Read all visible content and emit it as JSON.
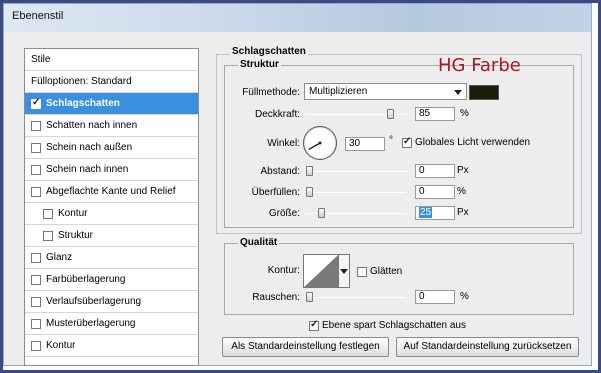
{
  "window": {
    "title": "Ebenenstil"
  },
  "left_panel": {
    "items": [
      {
        "label": "Stile",
        "has_checkbox": false,
        "checked": false,
        "indent": false,
        "selected": false
      },
      {
        "label": "Fülloptionen: Standard",
        "has_checkbox": false,
        "checked": false,
        "indent": false,
        "selected": false
      },
      {
        "label": "Schlagschatten",
        "has_checkbox": true,
        "checked": true,
        "indent": false,
        "selected": true
      },
      {
        "label": "Schatten nach innen",
        "has_checkbox": true,
        "checked": false,
        "indent": false,
        "selected": false
      },
      {
        "label": "Schein nach außen",
        "has_checkbox": true,
        "checked": false,
        "indent": false,
        "selected": false
      },
      {
        "label": "Schein nach innen",
        "has_checkbox": true,
        "checked": false,
        "indent": false,
        "selected": false
      },
      {
        "label": "Abgeflachte Kante und Relief",
        "has_checkbox": true,
        "checked": false,
        "indent": false,
        "selected": false
      },
      {
        "label": "Kontur",
        "has_checkbox": true,
        "checked": false,
        "indent": true,
        "selected": false
      },
      {
        "label": "Struktur",
        "has_checkbox": true,
        "checked": false,
        "indent": true,
        "selected": false
      },
      {
        "label": "Glanz",
        "has_checkbox": true,
        "checked": false,
        "indent": false,
        "selected": false
      },
      {
        "label": "Farbüberlagerung",
        "has_checkbox": true,
        "checked": false,
        "indent": false,
        "selected": false
      },
      {
        "label": "Verlaufsüberlagerung",
        "has_checkbox": true,
        "checked": false,
        "indent": false,
        "selected": false
      },
      {
        "label": "Musterüberlagerung",
        "has_checkbox": true,
        "checked": false,
        "indent": false,
        "selected": false
      },
      {
        "label": "Kontur",
        "has_checkbox": true,
        "checked": false,
        "indent": false,
        "selected": false
      }
    ]
  },
  "main": {
    "section_title": "Schlagschatten",
    "annotation": "HG Farbe",
    "annotation_color": "#b4161b",
    "structure": {
      "title": "Struktur",
      "fill_mode_label": "Füllmethode:",
      "fill_mode_value": "Multiplizieren",
      "shadow_color": "#1b1c08",
      "opacity_label": "Deckkraft:",
      "opacity_value": "85",
      "opacity_unit": "%",
      "opacity_level": 0.85,
      "angle_label": "Winkel:",
      "angle_value": "30",
      "angle_unit": "°",
      "global_light_label": "Globales Licht verwenden",
      "global_light_checked": true,
      "distance_label": "Abstand:",
      "distance_value": "0",
      "distance_unit": "Px",
      "spread_label": "Überfüllen:",
      "spread_value": "0",
      "spread_unit": "%",
      "size_label": "Größe:",
      "size_value": "25",
      "size_unit": "Px"
    },
    "quality": {
      "title": "Qualität",
      "contour_label": "Kontur:",
      "antialias_label": "Glätten",
      "antialias_checked": false,
      "noise_label": "Rauschen:",
      "noise_value": "0",
      "noise_unit": "%"
    },
    "knockout_label": "Ebene spart Schlagschatten aus",
    "knockout_checked": true,
    "btn_set_default": "Als Standardeinstellung festlegen",
    "btn_reset_default": "Auf Standardeinstellung zurücksetzen"
  }
}
